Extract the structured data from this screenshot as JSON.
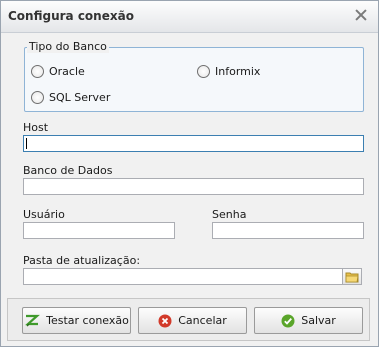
{
  "window": {
    "title": "Configura conexão"
  },
  "db_group": {
    "legend": "Tipo do Banco",
    "options": [
      "Oracle",
      "Informix",
      "SQL Server"
    ]
  },
  "host": {
    "label": "Host",
    "value": ""
  },
  "database": {
    "label": "Banco de Dados",
    "value": ""
  },
  "user": {
    "label": "Usuário",
    "value": ""
  },
  "password": {
    "label": "Senha",
    "value": ""
  },
  "update_folder": {
    "label": "Pasta de atualização:",
    "value": ""
  },
  "buttons": {
    "test": "Testar conexão",
    "cancel": "Cancelar",
    "save": "Salvar"
  },
  "colors": {
    "cancel_icon": "#d23a2a",
    "save_icon": "#5aa52a",
    "test_icon": "#3f9a2b",
    "folder_icon": "#e8c04a"
  }
}
